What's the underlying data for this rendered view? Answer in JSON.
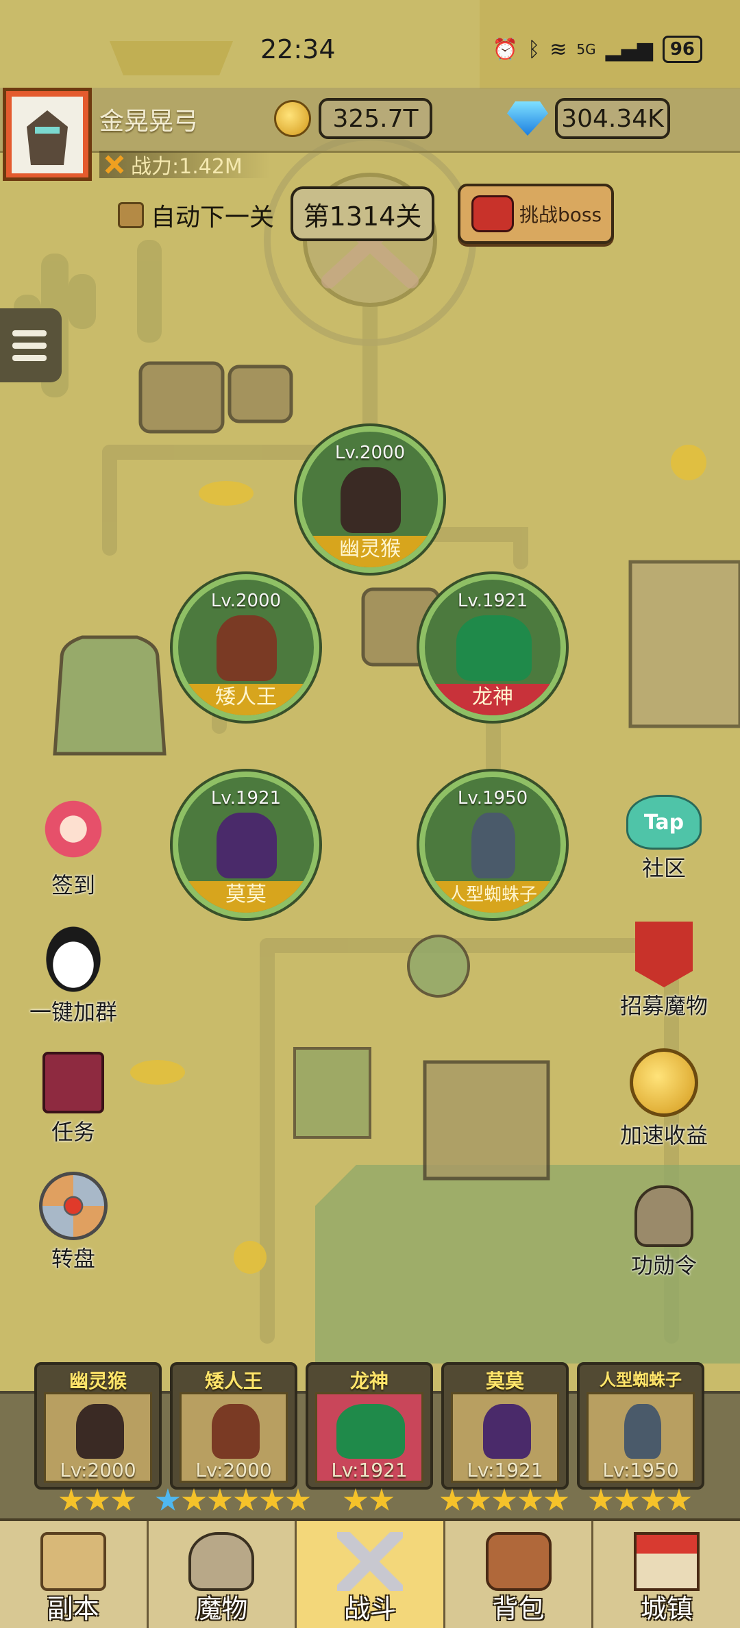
{
  "status_bar": {
    "time": "22:34",
    "network": "5G",
    "battery": "96"
  },
  "player": {
    "name": "金晃晃弓",
    "power": "战力:1.42M"
  },
  "resources": {
    "gold": "325.7T",
    "diamonds": "304.34K"
  },
  "level_controls": {
    "auto_next_label": "自动下一关",
    "auto_next_checked": false,
    "stage": "第1314关",
    "boss_button": "挑战boss"
  },
  "formation": [
    {
      "name": "幽灵猴",
      "level": "Lv.2000",
      "band": "gold"
    },
    {
      "name": "矮人王",
      "level": "Lv.2000",
      "band": "gold"
    },
    {
      "name": "龙神",
      "level": "Lv.1921",
      "band": "red"
    },
    {
      "name": "莫莫",
      "level": "Lv.1921",
      "band": "gold"
    },
    {
      "name": "人型蜘蛛子",
      "level": "Lv.1950",
      "band": "gold"
    }
  ],
  "side_left": [
    {
      "label": "签到",
      "icon": "catgirl-icon"
    },
    {
      "label": "一键加群",
      "icon": "penguin-icon"
    },
    {
      "label": "任务",
      "icon": "book-icon"
    },
    {
      "label": "转盘",
      "icon": "wheel-icon"
    }
  ],
  "side_right": [
    {
      "label": "社区",
      "icon": "taptap-icon",
      "badge": "Tap"
    },
    {
      "label": "招募魔物",
      "icon": "recruit-banner-icon"
    },
    {
      "label": "加速收益",
      "icon": "gold-coin-arrow-icon"
    },
    {
      "label": "功勋令",
      "icon": "helmet-icon"
    }
  ],
  "team": [
    {
      "name": "幽灵猴",
      "level": "Lv:2000",
      "stars": 3,
      "blue_stars": 0
    },
    {
      "name": "矮人王",
      "level": "Lv:2000",
      "stars": 5,
      "blue_stars": 1
    },
    {
      "name": "龙神",
      "level": "Lv:1921",
      "stars": 2,
      "blue_stars": 0
    },
    {
      "name": "莫莫",
      "level": "Lv:1921",
      "stars": 5,
      "blue_stars": 0
    },
    {
      "name": "人型蜘蛛子",
      "level": "Lv:1950",
      "stars": 4,
      "blue_stars": 0
    }
  ],
  "nav": [
    {
      "label": "副本",
      "icon": "map-scroll-icon",
      "active": false
    },
    {
      "label": "魔物",
      "icon": "viking-helmet-icon",
      "active": false
    },
    {
      "label": "战斗",
      "icon": "crossed-swords-icon",
      "active": true
    },
    {
      "label": "背包",
      "icon": "backpack-icon",
      "active": false
    },
    {
      "label": "城镇",
      "icon": "shop-building-icon",
      "active": false
    }
  ],
  "colors": {
    "background": "#c9bb6a",
    "monster_ring": "#8fc065",
    "band_gold": "#d7a51d",
    "band_red": "#c8323a",
    "active_tab": "#f3d77a"
  }
}
